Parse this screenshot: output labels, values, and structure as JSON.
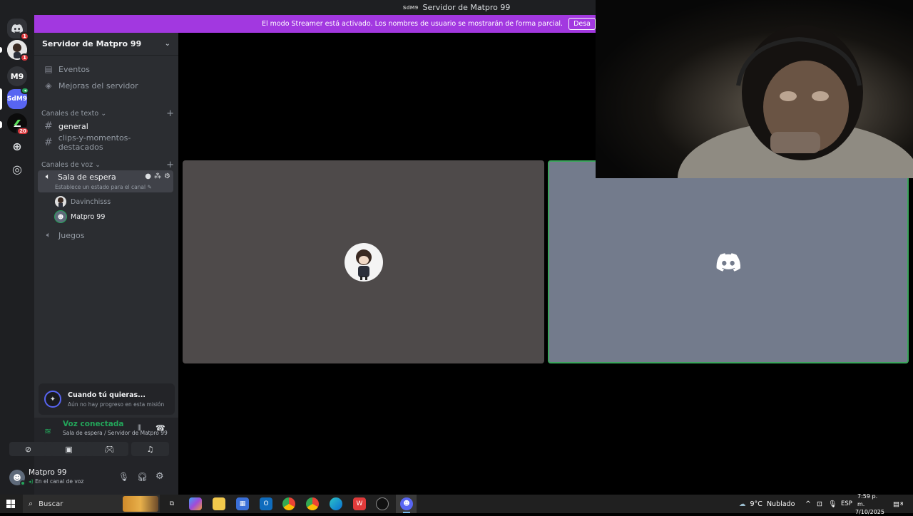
{
  "window": {
    "title": "Servidor de Matpro 99",
    "title_icon_text": "SdM9"
  },
  "rail": {
    "servers": [
      {
        "name": "dm-home",
        "badge": "1"
      },
      {
        "name": "avatar-server",
        "badge": "1"
      },
      {
        "name": "m9-server",
        "label": "M9"
      },
      {
        "name": "sdm9-server",
        "label": "SdM9"
      },
      {
        "name": "green-server",
        "badge": "20"
      }
    ],
    "colors": {
      "accent": "#5865f2",
      "badge": "#da373c"
    }
  },
  "banner": {
    "text": "El modo Streamer está activado. Los nombres de usuario se mostrarán de forma parcial.",
    "button_label": "Desa"
  },
  "sidebar": {
    "server_name": "Servidor de Matpro 99",
    "items": [
      {
        "label": "Eventos",
        "icon": "calendar-icon"
      },
      {
        "label": "Mejoras del servidor",
        "icon": "boost-icon"
      }
    ],
    "text_category": "Canales de texto",
    "text_channels": [
      "general",
      "clips-y-momentos-destacados"
    ],
    "voice_category": "Canales de voz",
    "voice_channels": [
      {
        "name": "Sala de espera",
        "status": "Establece un estado para el canal"
      },
      {
        "name": "Juegos"
      }
    ],
    "voice_users": [
      "Davinchisss",
      "Matpro 99"
    ]
  },
  "quest": {
    "title": "Cuando tú quieras...",
    "subtitle": "Aún no hay progreso en esta misión"
  },
  "voice": {
    "status": "Voz conectada",
    "location": "Sala de espera / Servidor de Matpro 99"
  },
  "user": {
    "name": "Matpro 99",
    "status": "En el canal de voz"
  },
  "taskbar": {
    "search_placeholder": "Buscar",
    "weather_temp": "9°C",
    "weather_desc": "Nublado",
    "language": "ESP",
    "time": "7:59 p. m.",
    "date": "7/10/2025",
    "notif_count": "8"
  },
  "colors": {
    "banner": "#a238e0",
    "connected_green": "#23a55a",
    "speaking_border": "#3ba55c"
  }
}
